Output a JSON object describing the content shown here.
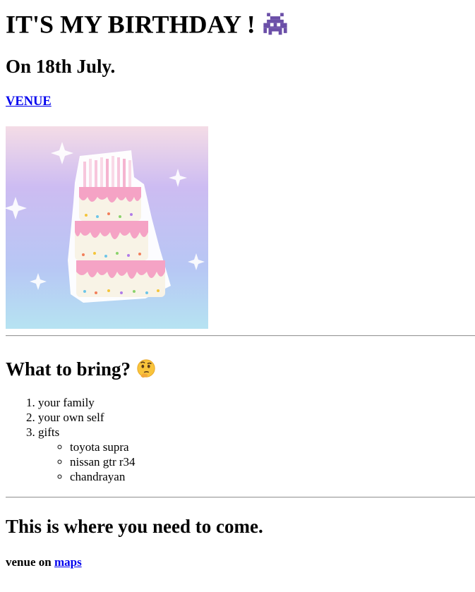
{
  "header": {
    "title": "IT'S MY BIRTHDAY !",
    "title_icon": "space-invader-alien-icon",
    "date_line": "On 18th July.",
    "venue_link_label": "VENUE"
  },
  "image": {
    "description_icon": "birthday-cake-image",
    "colors": {
      "bg_top": "#f3d9e8",
      "bg_mid": "#c6b8f3",
      "bg_bottom": "#b5e2f3",
      "frosting": "#f5a3c5",
      "cake_base": "#f8f3e6"
    }
  },
  "bring": {
    "heading": "What to bring?",
    "heading_icon": "thinking-face-icon",
    "items": [
      "your family",
      "your own self",
      "gifts"
    ],
    "gifts": [
      "toyota supra",
      "nissan gtr r34",
      "chandrayan"
    ]
  },
  "location": {
    "heading": "This is where you need to come.",
    "venue_prefix": "venue on ",
    "maps_label": "maps"
  },
  "colors": {
    "link": "#0000ee",
    "alien_purple": "#6b4fa8",
    "text": "#000000",
    "rule": "#9a9a9a"
  }
}
